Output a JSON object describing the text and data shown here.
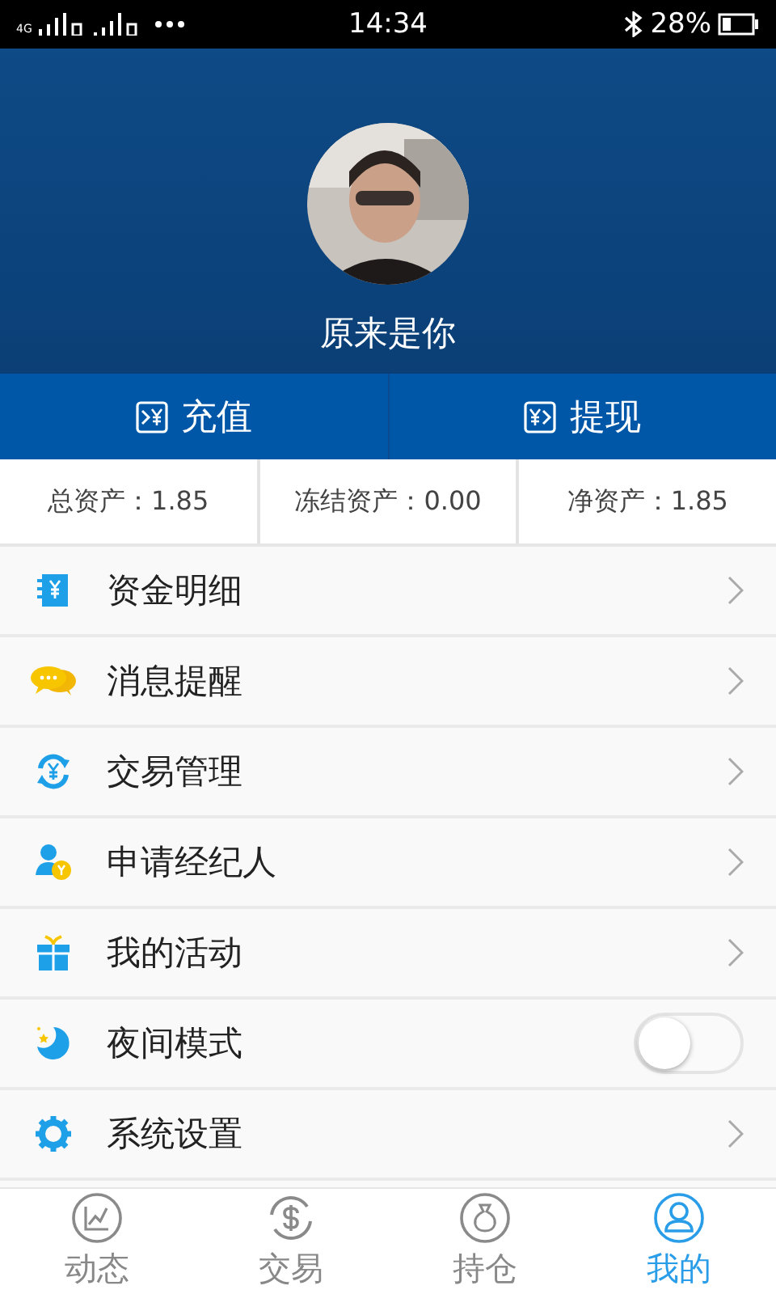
{
  "status_bar": {
    "network": "4G",
    "time": "14:34",
    "battery": "28%"
  },
  "profile": {
    "name": "原来是你"
  },
  "actions": [
    {
      "label": "充值"
    },
    {
      "label": "提现"
    }
  ],
  "stats": [
    "总资产：1.85",
    "冻结资产：0.00",
    "净资产：1.85"
  ],
  "menu": [
    {
      "label": "资金明细",
      "kind": "link"
    },
    {
      "label": "消息提醒",
      "kind": "link"
    },
    {
      "label": "交易管理",
      "kind": "link"
    },
    {
      "label": "申请经纪人",
      "kind": "link"
    },
    {
      "label": "我的活动",
      "kind": "link"
    },
    {
      "label": "夜间模式",
      "kind": "toggle",
      "on": false
    },
    {
      "label": "系统设置",
      "kind": "link"
    }
  ],
  "tabs": [
    {
      "label": "动态",
      "selected": false
    },
    {
      "label": "交易",
      "selected": false
    },
    {
      "label": "持仓",
      "selected": false
    },
    {
      "label": "我的",
      "selected": true
    }
  ]
}
